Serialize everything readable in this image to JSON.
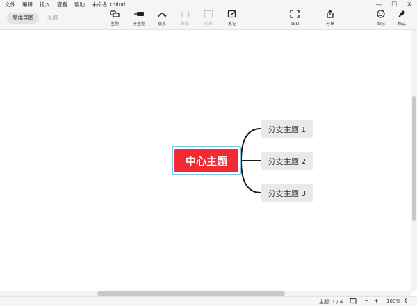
{
  "menu": [
    "文件",
    "编辑",
    "插入",
    "查看",
    "帮助"
  ],
  "filename": "未命名.xmind",
  "window_controls": [
    "—",
    "☐",
    "✕"
  ],
  "view_tabs": [
    {
      "label": "思维导图",
      "active": true
    },
    {
      "label": "大纲",
      "active": false
    }
  ],
  "toolbar": {
    "topic": {
      "label": "主题",
      "icon": "topic-icon"
    },
    "subtopic": {
      "label": "子主题",
      "icon": "subtopic-icon"
    },
    "relationship": {
      "label": "联系",
      "icon": "relationship-icon"
    },
    "summary": {
      "label": "概要",
      "icon": "summary-icon",
      "enabled": false
    },
    "boundary": {
      "label": "外框",
      "icon": "boundary-icon",
      "enabled": false
    },
    "notes": {
      "label": "笔记",
      "icon": "notes-icon"
    },
    "zen": {
      "label": "ZEN",
      "icon": "zen-icon"
    },
    "share": {
      "label": "分享",
      "icon": "share-icon"
    },
    "icons": {
      "label": "图标",
      "icon": "smiley-icon"
    },
    "style": {
      "label": "格式",
      "icon": "brush-icon"
    }
  },
  "mindmap": {
    "central_topic": "中心主题",
    "branches": [
      "分支主题 1",
      "分支主题 2",
      "分支主题 3"
    ],
    "central_color": "#f12a36",
    "line_color": "#1c1c1c"
  },
  "status": {
    "topic_count": "主题: 1 / 4",
    "zoom": "100%"
  }
}
